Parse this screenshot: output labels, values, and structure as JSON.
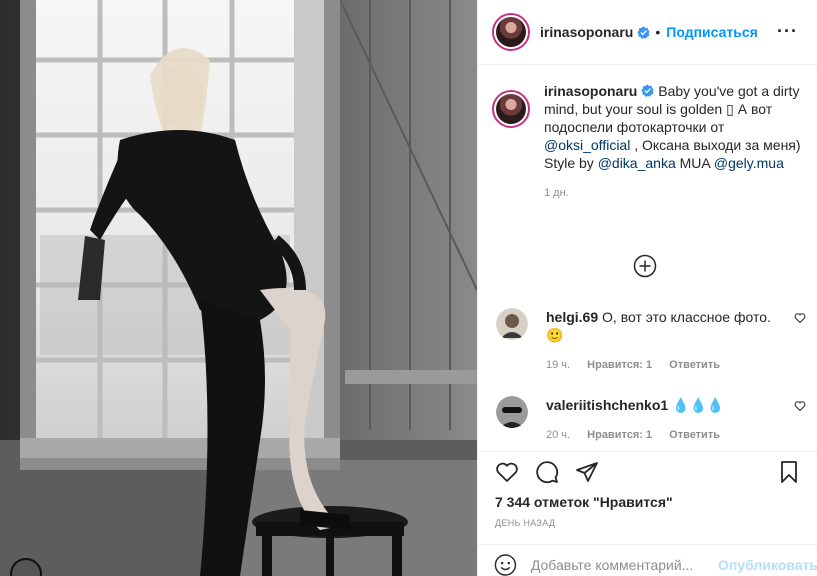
{
  "post": {
    "username": "irinasoponaru",
    "separator": "•",
    "follow_label": "Подписаться",
    "more_label": "···"
  },
  "caption": {
    "username": "irinasoponaru",
    "text_1": " Baby you've got a dirty mind, but your soul is golden ",
    "glyph": "▯",
    "text_2": " А вот подоспели фотокарточки от ",
    "mention_1": "@oksi_official",
    "text_3": " , Оксана выходи за меня) Style by ",
    "mention_2": "@dika_anka",
    "text_4": " MUA ",
    "mention_3": "@gely.mua",
    "time": "1 дн."
  },
  "comments": [
    {
      "username": "helgi.69",
      "text": " О, вот это классное фото.🙂",
      "time": "19 ч.",
      "likes": "Нравится: 1",
      "reply": "Ответить"
    },
    {
      "username": "valeriitishchenko1",
      "text": " 💧💧💧",
      "time": "20 ч.",
      "likes": "Нравится: 1",
      "reply": "Ответить"
    }
  ],
  "likes_text": "7 344 отметок \"Нравится\"",
  "date_text": "ДЕНЬ НАЗАД",
  "add_comment": {
    "placeholder": "Добавьте комментарий...",
    "publish_label": "Опубликовать"
  },
  "icons": [
    "verified-icon",
    "more-icon",
    "load-more-icon",
    "heart-icon",
    "comment-icon",
    "share-icon",
    "save-icon",
    "smiley-icon"
  ],
  "colors": {
    "link": "#0095f6",
    "mention": "#00376b",
    "muted": "#8e8e8e",
    "publish_disabled": "#b2dffc"
  }
}
